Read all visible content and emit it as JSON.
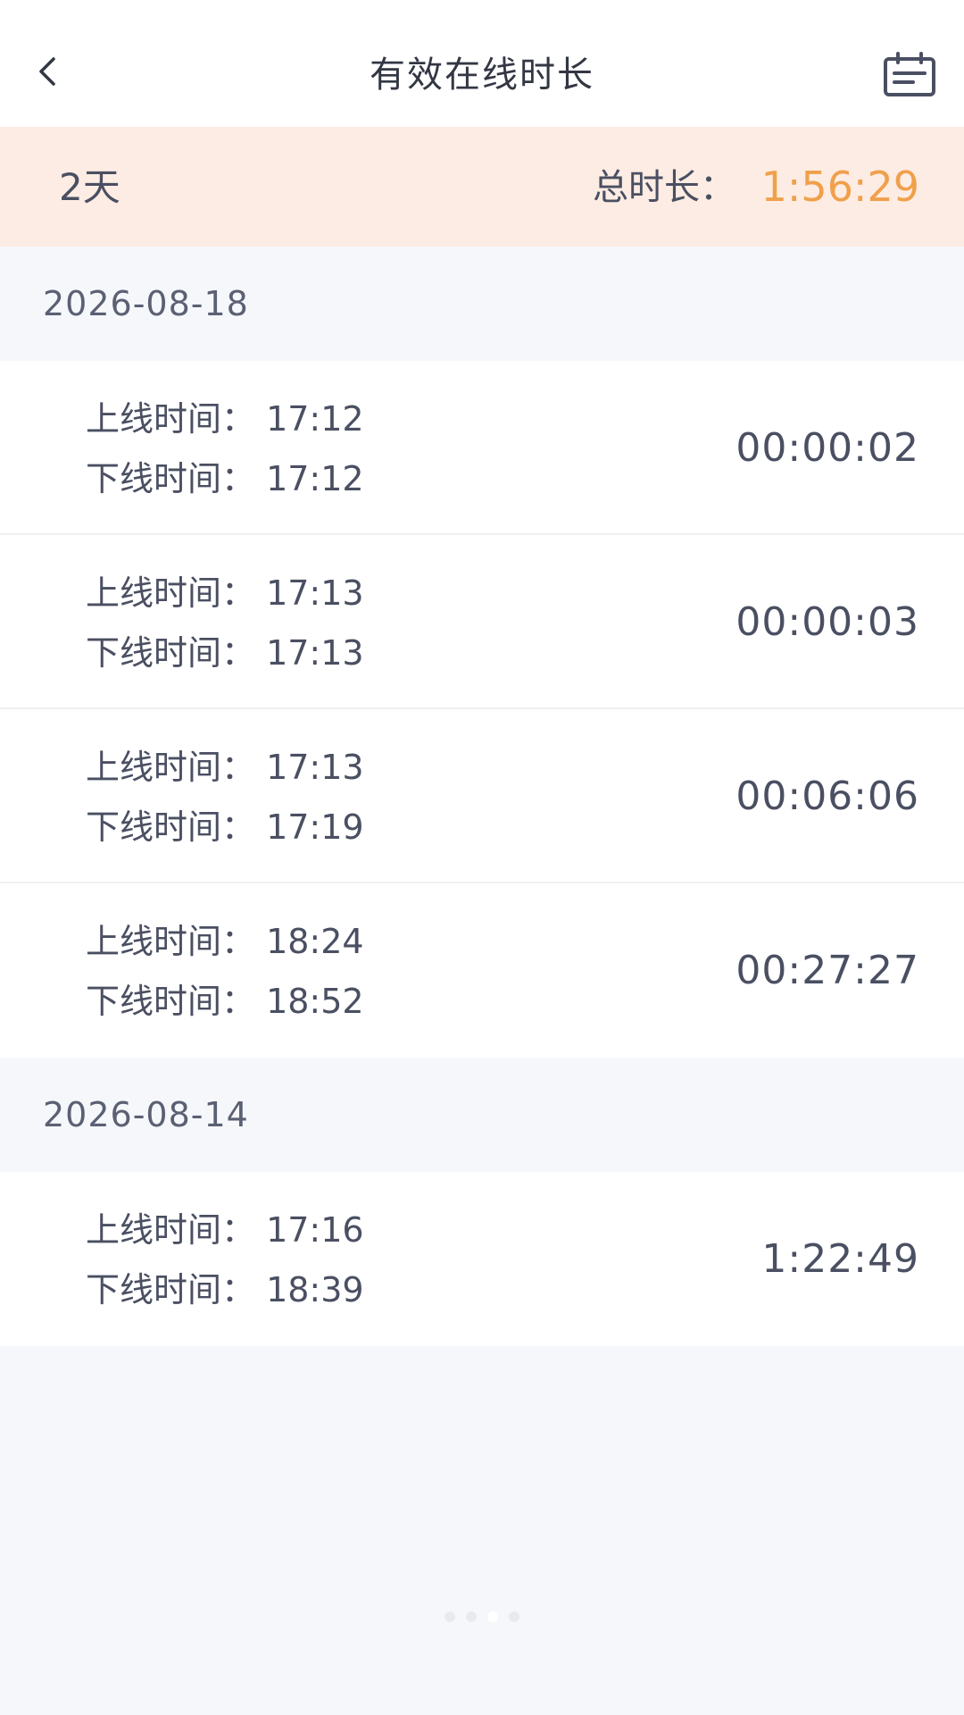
{
  "header": {
    "title": "有效在线时长",
    "back_icon": "chevron-left-icon",
    "calendar_icon": "calendar-icon"
  },
  "summary": {
    "days": "2天",
    "total_label": "总时长：",
    "total_value": "1:56:29",
    "total_color": "#f0a04b",
    "background": "#fdece3"
  },
  "groups": [
    {
      "date": "2026-08-18",
      "sessions": [
        {
          "online": "上线时间：  17:12",
          "offline": "下线时间：  17:12",
          "duration": "00:00:02"
        },
        {
          "online": "上线时间：  17:13",
          "offline": "下线时间：  17:13",
          "duration": "00:00:03"
        },
        {
          "online": "上线时间：  17:13",
          "offline": "下线时间：  17:19",
          "duration": "00:06:06"
        },
        {
          "online": "上线时间：  18:24",
          "offline": "下线时间：  18:52",
          "duration": "00:27:27"
        }
      ]
    },
    {
      "date": "2026-08-14",
      "sessions": [
        {
          "online": "上线时间：  17:16",
          "offline": "下线时间：  18:39",
          "duration": "1:22:49"
        }
      ]
    }
  ]
}
